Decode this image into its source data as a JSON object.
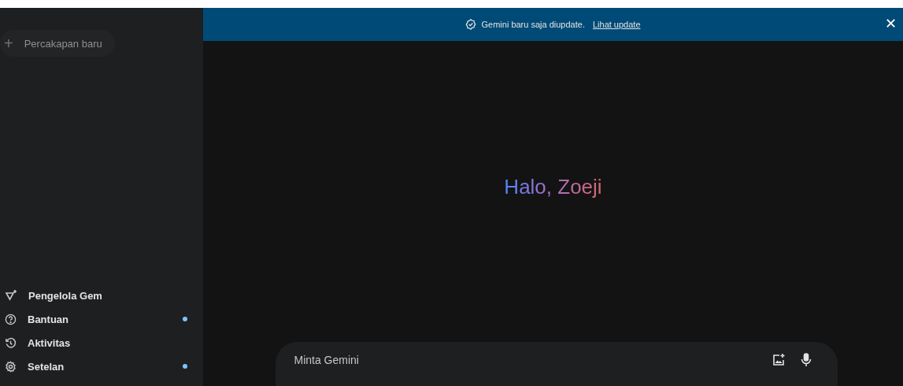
{
  "sidebar": {
    "new_chat": {
      "label": "Percakapan baru",
      "icon": "+"
    },
    "items": [
      {
        "label": "Pengelola Gem",
        "kind": "gem",
        "badge": false
      },
      {
        "label": "Bantuan",
        "kind": "help",
        "badge": true
      },
      {
        "label": "Aktivitas",
        "kind": "history",
        "badge": false
      },
      {
        "label": "Setelan",
        "kind": "settings",
        "badge": true
      }
    ]
  },
  "banner": {
    "message": "Gemini baru saja diupdate.",
    "link": "Lihat update",
    "close": "✕"
  },
  "greeting": "Halo, Zoeji",
  "prompt": {
    "placeholder": "Minta Gemini"
  }
}
